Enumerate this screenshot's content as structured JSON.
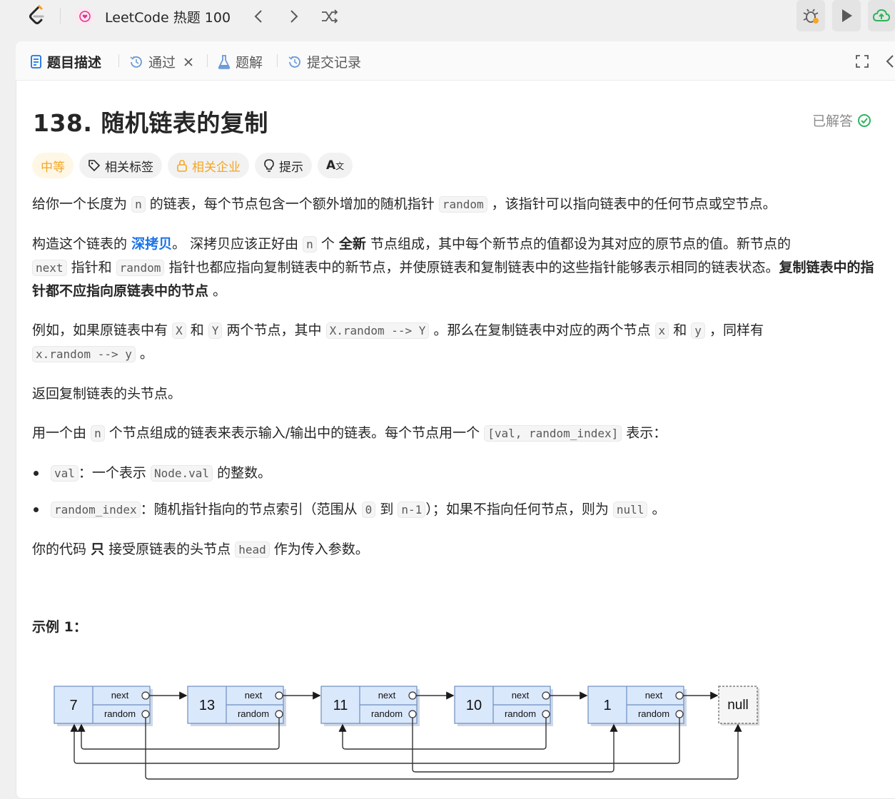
{
  "topbar": {
    "list_title": "LeetCode 热题 100",
    "icons": [
      "leetcode-logo",
      "heart-list-icon",
      "chevron-left-icon",
      "chevron-right-icon",
      "shuffle-icon",
      "debug-icon",
      "run-icon",
      "upload-cloud-icon"
    ]
  },
  "tabs": [
    {
      "label": "题目描述",
      "icon": "document-icon",
      "active": true
    },
    {
      "label": "通过",
      "icon": "history-icon",
      "closable": true
    },
    {
      "label": "题解",
      "icon": "flask-icon"
    },
    {
      "label": "提交记录",
      "icon": "history-icon"
    }
  ],
  "problem": {
    "title": "138. 随机链表的复制",
    "status": "已解答",
    "chips": {
      "difficulty": "中等",
      "tags": "相关标签",
      "companies": "相关企业",
      "hint": "提示",
      "translate": "A"
    },
    "p1": {
      "a": "给你一个长度为",
      "c1": "n",
      "b": "的链表，每个节点包含一个额外增加的随机指针",
      "c2": "random",
      "d": "，该指针可以指向链表中的任何节点或空节点。"
    },
    "p2": {
      "a": "构造这个链表的",
      "hl": "深拷贝",
      "b": "。 深拷贝应该正好由",
      "c1": "n",
      "d": "个",
      "bold1": "全新",
      "e": "节点组成，其中每个新节点的值都设为其对应的原节点的值。新节点的",
      "c2": "next",
      "f": "指针和",
      "c3": "random",
      "g": "指针也都应指向复制链表中的新节点，并使原链表和复制链表中的这些指针能够表示相同的链表状态。",
      "bold2": "复制链表中的指针都不应指向原链表中的节点",
      "h": "。"
    },
    "p3": {
      "a": "例如，如果原链表中有",
      "c1": "X",
      "b": "和",
      "c2": "Y",
      "d": "两个节点，其中",
      "c3": "X.random --> Y",
      "e": "。那么在复制链表中对应的两个节点",
      "c4": "x",
      "f": "和",
      "c5": "y",
      "g": "，同样有",
      "c6": "x.random --> y",
      "h": "。"
    },
    "p4": "返回复制链表的头节点。",
    "p5": {
      "a": "用一个由",
      "c1": "n",
      "b": "个节点组成的链表来表示输入/输出中的链表。每个节点用一个",
      "c2": "[val, random_index]",
      "d": "表示："
    },
    "li1": {
      "c1": "val",
      "a": "：一个表示",
      "c2": "Node.val",
      "b": "的整数。"
    },
    "li2": {
      "c1": "random_index",
      "a": "：随机指针指向的节点索引（范围从",
      "c2": "0",
      "b": "到",
      "c3": "n-1",
      "d": "）；如果不指向任何节点，则为",
      "c4": "null",
      "e": "。"
    },
    "p6": {
      "a": "你的代码",
      "bold": "只",
      "b": "接受原链表的头节点",
      "c1": "head",
      "d": "作为传入参数。"
    },
    "example_title": "示例 1："
  },
  "diagram": {
    "nodes": [
      "7",
      "13",
      "11",
      "10",
      "1"
    ],
    "next_label": "next",
    "random_label": "random",
    "null_label": "null"
  },
  "colors": {
    "accent": "#1a73e8",
    "difficulty": "#f5a623",
    "solved": "#2db55d"
  }
}
